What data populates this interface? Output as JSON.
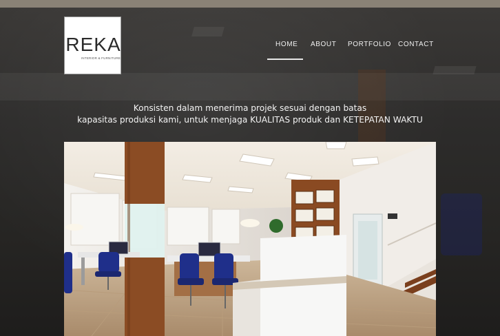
{
  "logo": {
    "wordmark": "REKA",
    "subtitle": "INTERIOR & FURNITURE"
  },
  "nav": {
    "items": [
      "HOME",
      "ABOUT",
      "PORTFOLIO",
      "CONTACT"
    ],
    "active": "HOME"
  },
  "tagline": {
    "line1": "Konsisten dalam menerima projek sesuai dengan batas",
    "line2": "kapasitas produksi kami, untuk menjaga KUALITAS produk dan KETEPATAN WAKTU"
  },
  "hero": {
    "image": "office-interior-render"
  },
  "colors": {
    "topbar": "#8a8276",
    "background": "#2d2c2b",
    "nav_text": "#f0f0f0",
    "chair_blue": "#1f2f8a",
    "wood": "#8a4a22"
  }
}
